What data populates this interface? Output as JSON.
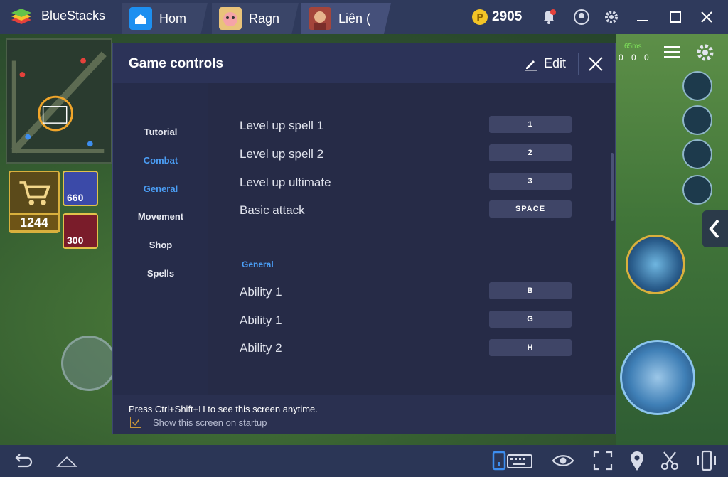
{
  "app": {
    "name": "BlueStacks"
  },
  "tabs": [
    {
      "label": "Hom",
      "icon": "home-icon"
    },
    {
      "label": "Ragn",
      "icon": "ragnarok-game-icon"
    },
    {
      "label": "Liên (",
      "icon": "lien-quan-game-icon"
    }
  ],
  "titlebar": {
    "coins": "2905",
    "icons": [
      "coin-icon",
      "bell-icon",
      "account-icon",
      "gear-icon",
      "minimize-icon",
      "maximize-icon",
      "close-icon"
    ]
  },
  "game": {
    "ping": "65ms",
    "stats": [
      "0",
      "0",
      "0"
    ],
    "gold": "1244",
    "items": [
      "660",
      "300"
    ],
    "icons": [
      "minimap",
      "shopping-cart-icon",
      "joystick",
      "skill-sword-icon",
      "skill-shield-icon",
      "skill-flag-icon",
      "chat-icon",
      "ultimate-skill-icon",
      "attack-fist-icon",
      "chevron-left-icon",
      "menu-icon",
      "settings-icon"
    ]
  },
  "dialog": {
    "title": "Game controls",
    "edit_label": "Edit",
    "nav": [
      "Tutorial",
      "Combat",
      "General",
      "Movement",
      "Shop",
      "Spells"
    ],
    "active_nav": [
      "Combat",
      "General"
    ],
    "rows": [
      {
        "label": "Level up spell 1",
        "key": "1"
      },
      {
        "label": "Level up spell 2",
        "key": "2"
      },
      {
        "label": "Level up ultimate",
        "key": "3"
      },
      {
        "label": "Basic attack",
        "key": "SPACE"
      }
    ],
    "section": "General",
    "rows2": [
      {
        "label": "Ability 1",
        "key": "B"
      },
      {
        "label": "Ability 1",
        "key": "G"
      },
      {
        "label": "Ability 2",
        "key": "H"
      }
    ],
    "footer_hint": "Press Ctrl+Shift+H to see this screen anytime.",
    "startup_label": "Show this screen on startup",
    "startup_checked": true
  },
  "bottombar": {
    "icons": [
      "back-icon",
      "home-icon",
      "keyboard-toggle-icon",
      "eye-icon",
      "fullscreen-icon",
      "location-icon",
      "scissors-icon",
      "rotate-phone-icon"
    ]
  },
  "colors": {
    "accent": "#4b9ef5",
    "dialog_bg": "#232845",
    "titlebar_bg": "#2f3a5c",
    "checkbox": "#c9953a",
    "coin": "#f3c427"
  }
}
